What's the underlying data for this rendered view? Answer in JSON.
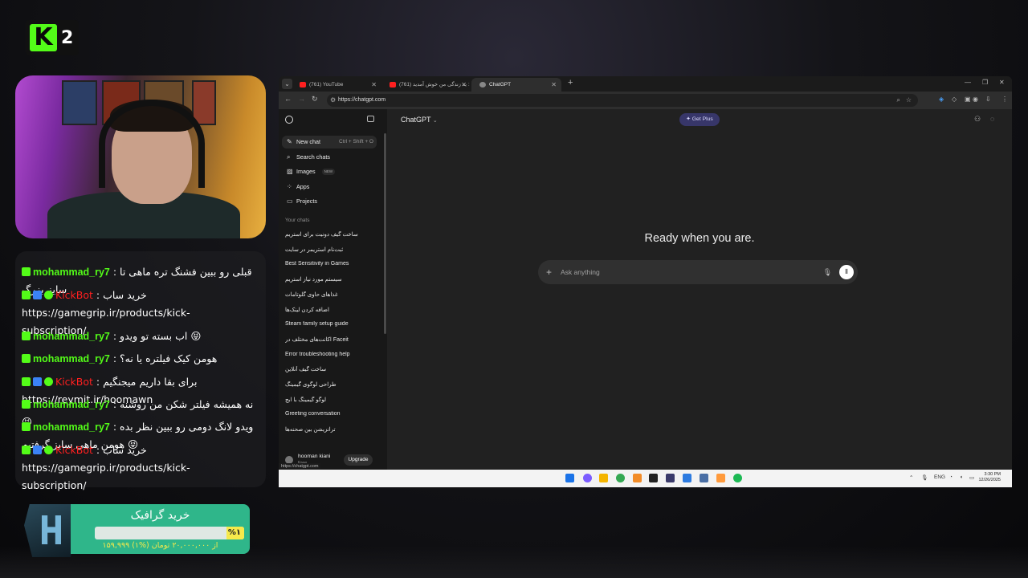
{
  "overlay": {
    "logo_letter": "K",
    "logo_number": "2"
  },
  "chat": [
    {
      "badges": [
        "kick"
      ],
      "user": "mohammad_ry7",
      "message": " : قبلی رو ببین فشنگ تره ماهی تا سایز بزرگ",
      "is_bot": false
    },
    {
      "badges": [
        "kick",
        "bot",
        "verified"
      ],
      "user": "KickBot",
      "message": " : خرید ساب https://gamegrip.ir/products/kick-subscription/",
      "is_bot": true
    },
    {
      "badges": [
        "kick"
      ],
      "user": "mohammad_ry7",
      "message": " : اب بسته تو ویدو 😝",
      "is_bot": false
    },
    {
      "badges": [
        "kick"
      ],
      "user": "mohammad_ry7",
      "message": " : هومن کیک فیلتره یا نه؟",
      "is_bot": false
    },
    {
      "badges": [
        "kick",
        "bot",
        "verified"
      ],
      "user": "KickBot",
      "message": " : برای بقا داریم میجنگیم https://reymit.ir/hoomawn",
      "is_bot": true
    },
    {
      "badges": [
        "kick"
      ],
      "user": "mohammad_ry7",
      "message": " : نه همیشه فیلتر شکن من روشنه 😝",
      "is_bot": false
    },
    {
      "badges": [
        "kick"
      ],
      "user": "mohammad_ry7",
      "message": " : ویدو لانگ دومی رو ببین نظر بده هومن ماهی سایز گرفتیم 😝",
      "is_bot": false
    },
    {
      "badges": [
        "kick",
        "bot",
        "verified"
      ],
      "user": "KickBot",
      "message": " : خرید ساب https://gamegrip.ir/products/kick-subscription/",
      "is_bot": true
    }
  ],
  "donation": {
    "title": "خرید گرافیک",
    "percent_label": "%۱",
    "progress_fraction": 0.01,
    "amount_text": "۱۵۹,۹۹۹ از ۲۰,۰۰۰,۰۰۰ تومان (%۱)"
  },
  "browser": {
    "tabs": [
      {
        "label": "(761) YouTube",
        "favicon": "youtube",
        "active": false
      },
      {
        "label": "(761) به زندگی من خوش آمدید :",
        "favicon": "youtube",
        "active": false
      },
      {
        "label": "ChatGPT",
        "favicon": "chatgpt",
        "active": true
      }
    ],
    "url": "https://chatgpt.com",
    "status_url": "https://chatgpt.com"
  },
  "chatgpt": {
    "model_label": "ChatGPT",
    "get_plus_label": "Get Plus",
    "nav": [
      {
        "label": "New chat",
        "shortcut": "Ctrl + Shift + O",
        "icon": "edit-icon"
      },
      {
        "label": "Search chats",
        "icon": "search-icon"
      },
      {
        "label": "Images",
        "badge": "NEW",
        "icon": "image-icon"
      },
      {
        "label": "Apps",
        "icon": "apps-icon"
      },
      {
        "label": "Projects",
        "icon": "folder-icon"
      }
    ],
    "section_label": "Your chats",
    "chats": [
      "ساخت گیف دونیت برای استریم",
      "ثبت‌نام استریمر در سایت",
      "Best Sensitivity in Games",
      "سیستم مورد نیاز استریم",
      "غذاهای حاوی گلوتامات",
      "اضافه کردن لینک‌ها",
      "Steam family setup guide",
      "اکانت‌های مختلف در Faceit",
      "Error troubleshooting help",
      "ساخت گیف آنلاین",
      "طراحی لوگوی گیمینگ",
      "لوگو گیمینگ با ابج",
      "Greeting conversation",
      "ترانزیشن بین صحنه‌ها"
    ],
    "user_name": "hooman kiani",
    "user_plan": "Free",
    "upgrade_label": "Upgrade",
    "headline": "Ready when you are.",
    "input_placeholder": "Ask anything"
  },
  "taskbar": {
    "lang": "ENG",
    "time": "3:30 PM",
    "date": "12/26/2025"
  }
}
